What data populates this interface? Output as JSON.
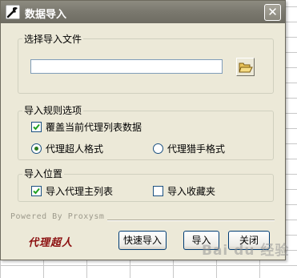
{
  "window": {
    "title": "数据导入",
    "app_icon": "wrench-icon",
    "close_label": "✕"
  },
  "file_group": {
    "legend": "选择导入文件",
    "path_value": "",
    "browse_icon": "open-folder-icon"
  },
  "rules_group": {
    "legend": "导入规则选项",
    "overwrite_label": "覆盖当前代理列表数据",
    "overwrite_checked": true,
    "format_options": [
      {
        "label": "代理超人格式",
        "selected": true
      },
      {
        "label": "代理猎手格式",
        "selected": false
      }
    ]
  },
  "location_group": {
    "legend": "导入位置",
    "main_list_label": "导入代理主列表",
    "main_list_checked": true,
    "favorites_label": "导入收藏夹",
    "favorites_checked": false
  },
  "footer": {
    "powered_by": "Powered By Proxysm",
    "logo_text": "代理超人",
    "quick_import_label": "快速导入",
    "import_label": "导入",
    "close_button_label": "关闭"
  },
  "watermark": "Bai du 经验",
  "colors": {
    "titlebar": "#7a786e",
    "dialog_bg": "#ece9d8",
    "check_green": "#2b7b1e",
    "logo_red": "#8c1010"
  }
}
